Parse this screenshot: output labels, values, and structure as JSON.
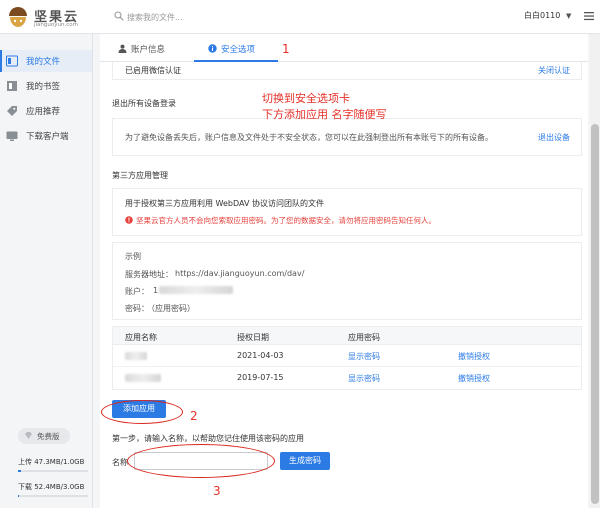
{
  "app": {
    "logo_title": "坚果云",
    "logo_subtitle": "jianguoyun.com"
  },
  "search": {
    "placeholder": "搜索我的文件..."
  },
  "user": {
    "name": "白白0110",
    "caret": "▼"
  },
  "sidebar": {
    "items": [
      {
        "label": "我的文件",
        "icon": "folder-icon",
        "active": true
      },
      {
        "label": "我的书签",
        "icon": "bookmark-icon",
        "active": false
      },
      {
        "label": "应用推荐",
        "icon": "tag-icon",
        "active": false
      },
      {
        "label": "下载客户端",
        "icon": "monitor-icon",
        "active": false
      }
    ],
    "plan_label": "免费版",
    "upload_quota": "上传 47.3MB/1.0GB",
    "upload_fraction": 0.046,
    "download_quota": "下载 52.4MB/3.0GB",
    "download_fraction": 0.017
  },
  "tabs": [
    {
      "label": "账户信息",
      "icon": "user-icon",
      "active": false
    },
    {
      "label": "安全选项",
      "icon": "info-icon",
      "active": true
    }
  ],
  "security": {
    "wechat_status": "已启用微信认证",
    "wechat_action": "关闭认证",
    "logout_all_title": "退出所有设备登录",
    "logout_all_desc": "为了避免设备丢失后，账户信息及文件处于不安全状态，您可以在此强制登出所有本账号下的所有设备。",
    "logout_all_action": "退出设备"
  },
  "third_party": {
    "title": "第三方应用管理",
    "desc": "用于授权第三方应用利用 WebDAV 协议访问团队的文件",
    "warning": "坚果云官方人员不会向您索取应用密码。为了您的数据安全，请勿将应用密码告知任何人。",
    "example_title": "示例",
    "server_label": "服务器地址：",
    "server_value": "https://dav.jianguoyun.com/dav/",
    "account_label": "账户：",
    "account_value": "1",
    "password_label": "密码：",
    "password_value": "（应用密码）"
  },
  "app_table": {
    "headers": [
      "应用名称",
      "授权日期",
      "应用密码",
      ""
    ],
    "rows": [
      {
        "date": "2021-04-03",
        "show": "显示密码",
        "revoke": "撤销授权"
      },
      {
        "date": "2019-07-15",
        "show": "显示密码",
        "revoke": "撤销授权"
      }
    ]
  },
  "add_app": {
    "button_label": "添加应用",
    "step_text": "第一步，请输入名称，以帮助您记住使用该密码的应用",
    "name_label": "名称",
    "name_value": "",
    "generate_label": "生成密码"
  },
  "annotations": {
    "n1": "1",
    "n2": "2",
    "n3": "3",
    "note_line1": "切换到安全选项卡",
    "note_line2": "下方添加应用  名字随便写"
  },
  "colors": {
    "accent": "#2c7be5",
    "warning": "#e5423c",
    "annotation": "#e53027"
  }
}
